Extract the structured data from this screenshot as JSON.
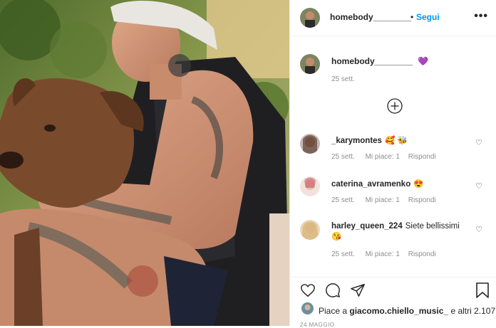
{
  "post": {
    "username": "homebody________",
    "separator": "•",
    "follow_label": "Segui",
    "more_label": "•••",
    "caption_emoji": "💜",
    "caption_date": "25 sett.",
    "load_more_icon": "plus-circle-icon"
  },
  "comments": [
    {
      "username": "_karymontes",
      "text": "🥰 🐝",
      "date": "25 sett.",
      "likes": "Mi piace: 1",
      "reply": "Rispondi"
    },
    {
      "username": "caterina_avramenko",
      "text": "😍",
      "date": "25 sett.",
      "likes": "Mi piace: 1",
      "reply": "Rispondi"
    },
    {
      "username": "harley_queen_224",
      "text": "Siete bellissimi",
      "emoji": "😘",
      "date": "25 sett.",
      "likes": "Mi piace: 1",
      "reply": "Rispondi"
    }
  ],
  "actions": {
    "icons": [
      "heart-icon",
      "comment-icon",
      "share-icon",
      "bookmark-icon"
    ]
  },
  "likes": {
    "prefix": "Piace a",
    "user": "giacomo.chiello_music_",
    "suffix": "e altri 2.107"
  },
  "footer_date": "24 MAGGIO",
  "colors": {
    "follow": "#0095f6",
    "meta": "#8e8e8e",
    "border": "#efefef",
    "text": "#262626"
  }
}
